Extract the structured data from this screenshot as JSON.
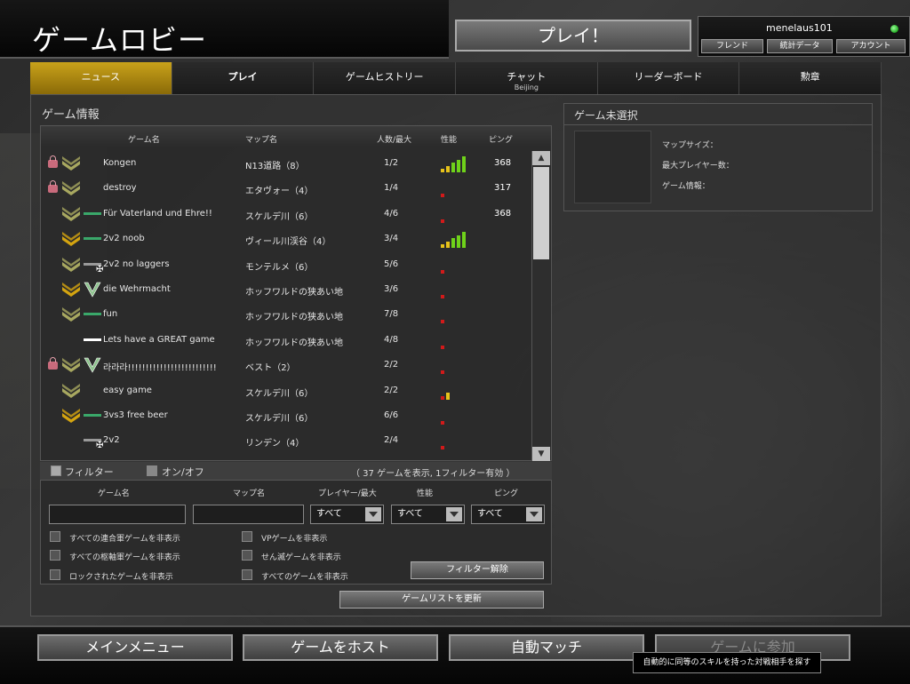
{
  "header": {
    "title": "ゲームロビー",
    "play_label": "プレイ！",
    "username": "menelaus101",
    "buttons": [
      "フレンド",
      "統計データ",
      "アカウント"
    ]
  },
  "tabs": [
    {
      "label": "ニュース",
      "active": true
    },
    {
      "label": "プレイ",
      "bold": true
    },
    {
      "label": "ゲームヒストリー"
    },
    {
      "label": "チャット",
      "sub": "Beijing"
    },
    {
      "label": "リーダーボード"
    },
    {
      "label": "勲章"
    }
  ],
  "game_info": {
    "title": "ゲーム情報",
    "columns": {
      "name": "ゲーム名",
      "map": "マップ名",
      "players": "人数/最大",
      "perf": "性能",
      "ping": "ピング"
    },
    "rows": [
      {
        "name": "Kongen",
        "map": "N13道路（8）",
        "players": "1/2",
        "perf": 5,
        "ping": "368",
        "lock": true,
        "rank": "chevron"
      },
      {
        "name": "destroy",
        "map": "エタヴォー（4）",
        "players": "1/4",
        "perf": 1,
        "ping": "317",
        "lock": true,
        "rank": "chevron2"
      },
      {
        "name": "Für Vaterland und Ehre!!",
        "map": "スケルデ川（6）",
        "players": "4/6",
        "perf": 1,
        "ping": "368",
        "rank": "chevron3",
        "bar": "green"
      },
      {
        "name": "2v2 noob",
        "map": "ヴィール川渓谷（4）",
        "players": "3/4",
        "perf": 5,
        "ping": "",
        "rank": "sergeant",
        "bar": "green"
      },
      {
        "name": "2v2 no laggers",
        "map": "モンテルメ（6）",
        "players": "5/6",
        "perf": 1,
        "ping": "",
        "rank": "crown",
        "bar": "grey",
        "cross": true
      },
      {
        "name": "die Wehrmacht",
        "map": "ホッフワルドの狭あい地",
        "players": "3/6",
        "perf": 1,
        "ping": "",
        "rank": "gold",
        "bar": "v"
      },
      {
        "name": "fun",
        "map": "ホッフワルドの狭あい地",
        "players": "7/8",
        "perf": 1,
        "ping": "",
        "rank": "wreath",
        "bar": "green"
      },
      {
        "name": "Lets have a GREAT game",
        "map": "ホッフワルドの狭あい地",
        "players": "4/8",
        "perf": 1,
        "ping": "",
        "bar": "white"
      },
      {
        "name": "라라라!!!!!!!!!!!!!!!!!!!!!!!!!!!!!!!!!!",
        "map": "ベスト（2）",
        "players": "2/2",
        "perf": 1,
        "ping": "",
        "lock": true,
        "rank": "chevron",
        "bar": "v"
      },
      {
        "name": "easy game",
        "map": "スケルデ川（6）",
        "players": "2/2",
        "perf": 2,
        "ping": "",
        "rank": "crown"
      },
      {
        "name": "3vs3 free beer",
        "map": "スケルデ川（6）",
        "players": "6/6",
        "perf": 1,
        "ping": "",
        "rank": "sergeant",
        "bar": "green"
      },
      {
        "name": "2v2",
        "map": "リンデン（4）",
        "players": "2/4",
        "perf": 1,
        "ping": "",
        "bar": "grey",
        "cross": true
      }
    ]
  },
  "filter": {
    "toggle_label": "フィルター",
    "onoff_label": "オン/オフ",
    "summary": "（ 37 ゲームを表示, 1フィルター有効 ）",
    "labels": [
      "ゲーム名",
      "マップ名",
      "プレイヤー/最大",
      "性能",
      "ピング"
    ],
    "select_value": "すべて",
    "checks": [
      "すべての連合軍ゲームを非表示",
      "すべての枢軸軍ゲームを非表示",
      "ロックされたゲームを非表示",
      "VPゲームを非表示",
      "せん滅ゲームを非表示",
      "すべてのゲームを非表示"
    ],
    "clear_label": "フィルター解除",
    "refresh_label": "ゲームリストを更新"
  },
  "selected": {
    "title": "ゲーム未選択",
    "labels": [
      "マップサイズ：",
      "最大プレイヤー数：",
      "ゲーム情報："
    ]
  },
  "bottom": {
    "buttons": [
      "メインメニュー",
      "ゲームをホスト",
      "自動マッチ",
      "ゲームに参加"
    ],
    "tooltip": "自動的に同等のスキルを持った対戦相手を探す"
  },
  "colors": {
    "accent": "#c9a21a",
    "perf_green": "#6fd21a",
    "perf_yellow": "#e6c21a",
    "perf_red": "#d21a1a"
  }
}
